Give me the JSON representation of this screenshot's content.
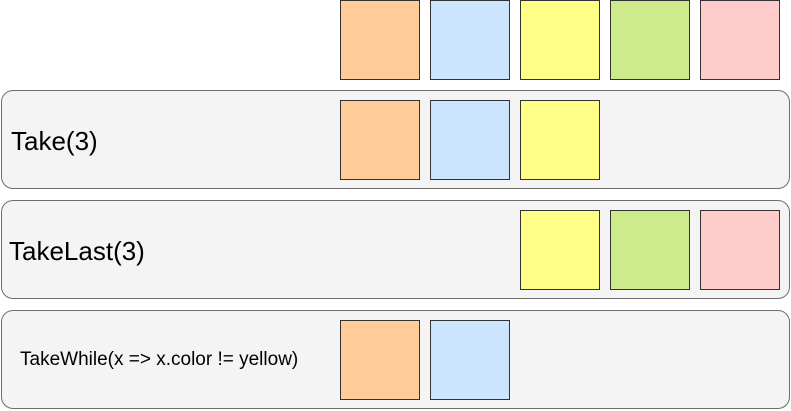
{
  "colors": {
    "orange": "#ffcc99",
    "blue": "#cce5ff",
    "yellow": "#ffff88",
    "green": "#cdeb8b",
    "pink": "#ffcccc"
  },
  "source_sequence": [
    "orange",
    "blue",
    "yellow",
    "green",
    "pink"
  ],
  "operations": [
    {
      "label": "Take(3)",
      "result": [
        "orange",
        "blue",
        "yellow"
      ]
    },
    {
      "label": "TakeLast(3)",
      "result": [
        "yellow",
        "green",
        "pink"
      ]
    },
    {
      "label": "TakeWhile(x => x.color != yellow)",
      "result": [
        "orange",
        "blue"
      ]
    }
  ]
}
